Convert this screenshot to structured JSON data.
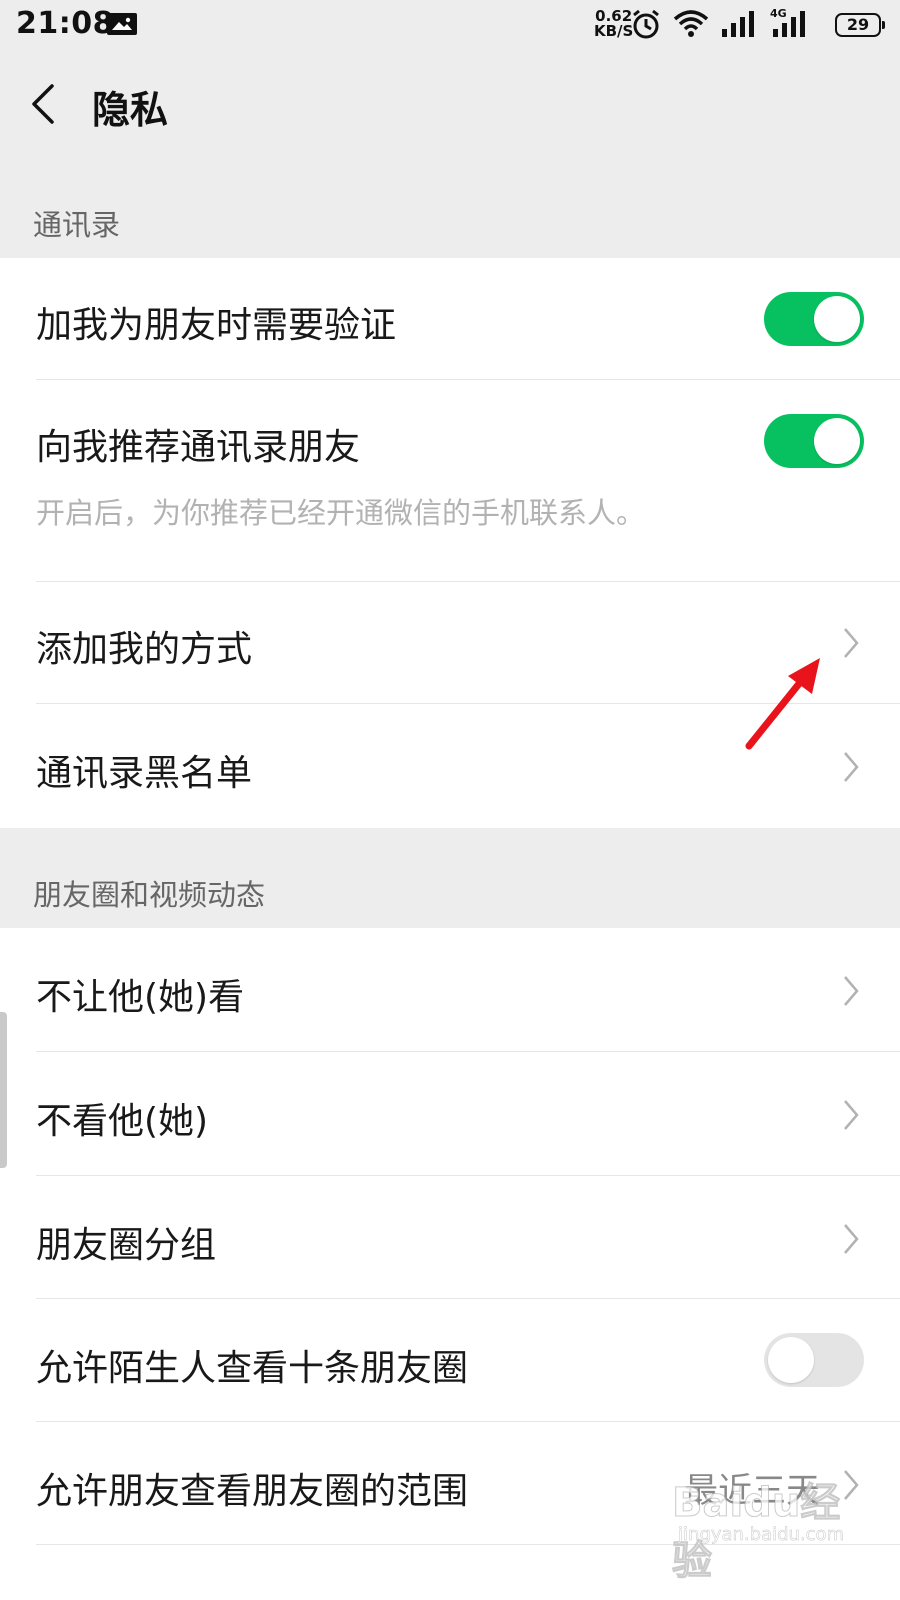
{
  "status_bar": {
    "time": "21:08",
    "speed_value": "0.62",
    "speed_unit": "KB/S",
    "network_label": "4G",
    "battery": "29",
    "icons": [
      "message-icon",
      "alarm-icon",
      "wifi-icon",
      "signal-icon",
      "signal-4g-icon",
      "battery-icon"
    ]
  },
  "nav": {
    "title": "隐私",
    "back_icon": "chevron-left-icon"
  },
  "sections": {
    "contacts": {
      "header": "通讯录",
      "rows": {
        "verify": {
          "label": "加我为朋友时需要验证",
          "toggle": "on"
        },
        "recommend": {
          "label": "向我推荐通讯录朋友",
          "toggle": "on",
          "description": "开启后，为你推荐已经开通微信的手机联系人。"
        },
        "add_methods": {
          "label": "添加我的方式"
        },
        "blacklist": {
          "label": "通讯录黑名单"
        }
      }
    },
    "moments": {
      "header": "朋友圈和视频动态",
      "rows": {
        "hide_from": {
          "label": "不让他(她)看"
        },
        "dont_see": {
          "label": "不看他(她)"
        },
        "groups": {
          "label": "朋友圈分组"
        },
        "strangers": {
          "label": "允许陌生人查看十条朋友圈",
          "toggle": "off"
        },
        "range": {
          "label": "允许朋友查看朋友圈的范围",
          "value": "最近三天"
        }
      }
    }
  },
  "colors": {
    "toggle_on": "#07c160",
    "toggle_off": "#e4e4e4",
    "background": "#ededed",
    "annotation_arrow": "#e8131b"
  },
  "watermark": {
    "main": "Baidu经验",
    "sub": "jingyan.baidu.com"
  }
}
